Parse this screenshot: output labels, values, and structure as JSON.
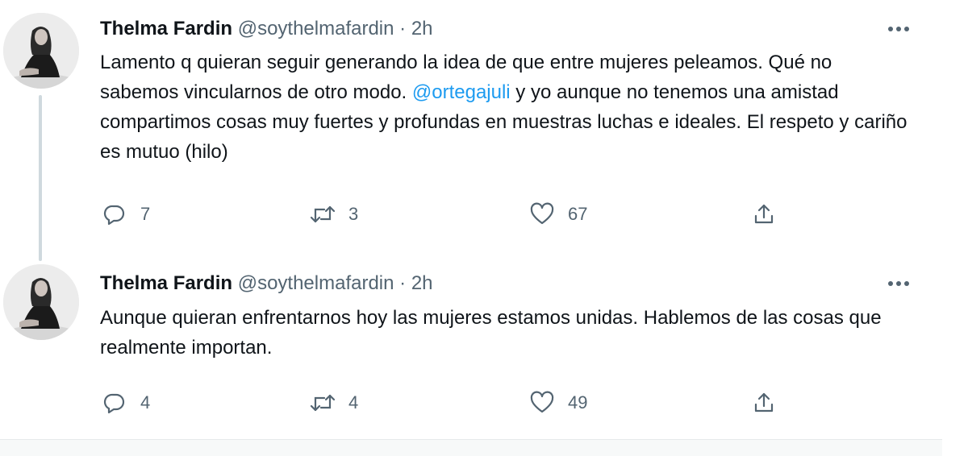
{
  "colors": {
    "name_text": "#0f1419",
    "secondary_text": "#536471",
    "mention": "#1d9bf0",
    "thread_line": "#cfd9de"
  },
  "tweets": [
    {
      "display_name": "Thelma Fardin",
      "handle": "@soythelmafardin",
      "separator": "·",
      "time": "2h",
      "more_icon": "more-dots-icon",
      "text_before": "Lamento q quieran seguir generando la idea de que entre mujeres peleamos. Qué no sabemos vincularnos de otro modo. ",
      "mention": "@ortegajuli",
      "text_after": " y yo aunque no tenemos una amistad compartimos cosas muy fuertes y profundas en muestras luchas e ideales. El respeto y cariño es mutuo (hilo)",
      "replies": "7",
      "retweets": "3",
      "likes": "67"
    },
    {
      "display_name": "Thelma Fardin",
      "handle": "@soythelmafardin",
      "separator": "·",
      "time": "2h",
      "more_icon": "more-dots-icon",
      "text": "Aunque quieran enfrentarnos hoy las mujeres estamos unidas. Hablemos de las cosas que realmente importan.",
      "replies": "4",
      "retweets": "4",
      "likes": "49"
    }
  ],
  "icons": {
    "reply": "reply-icon",
    "retweet": "retweet-icon",
    "like": "heart-icon",
    "share": "share-icon"
  }
}
